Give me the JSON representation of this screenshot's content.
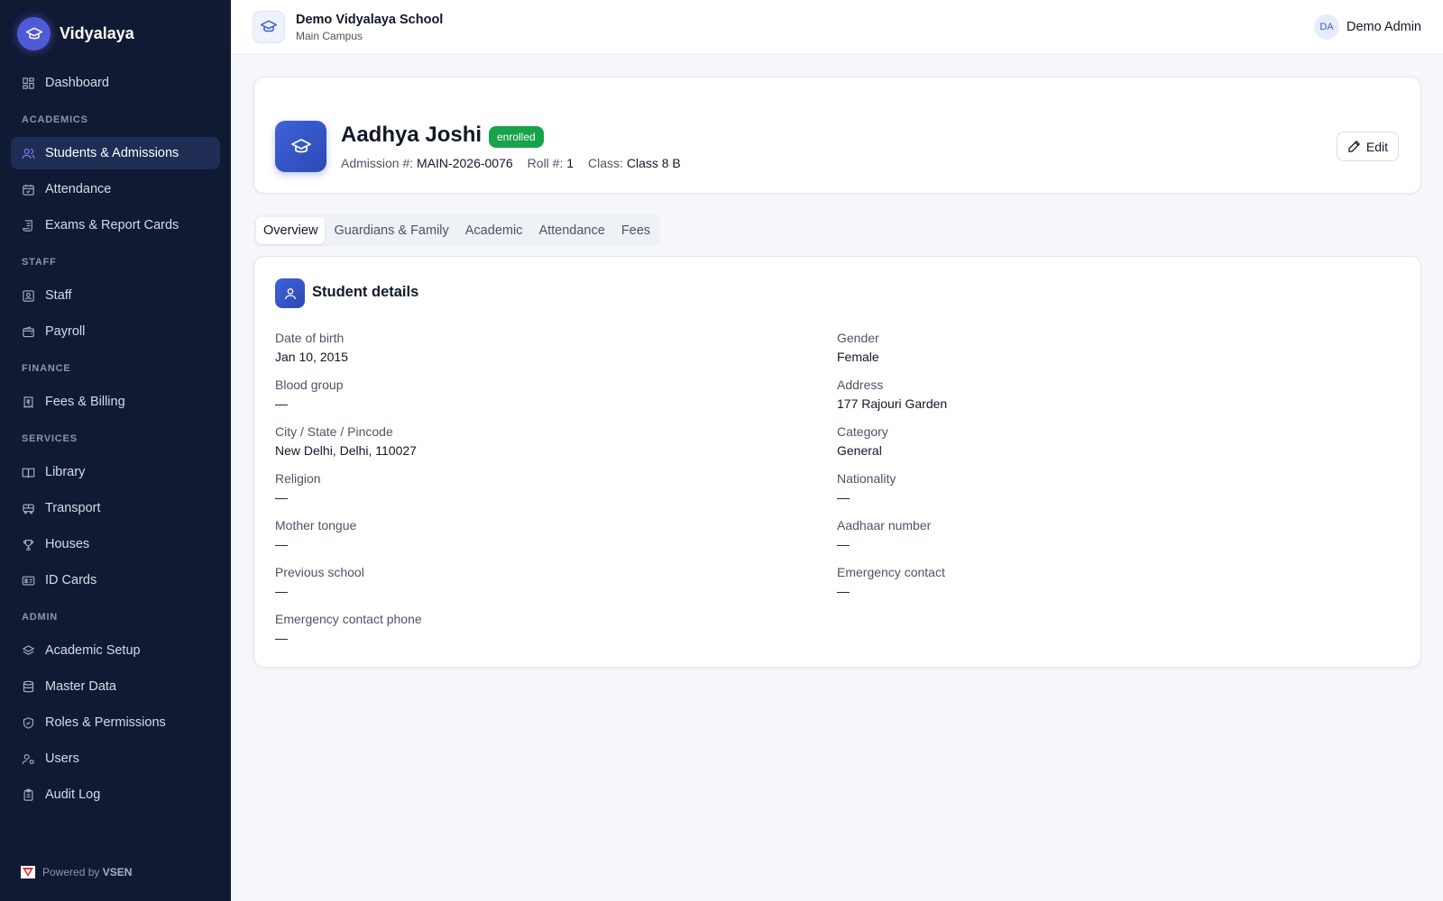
{
  "app": {
    "name": "Vidyalaya",
    "powered_by_prefix": "Powered by",
    "powered_by_brand": "VSEN"
  },
  "sidebar": {
    "dashboard": "Dashboard",
    "sections": {
      "academics": "ACADEMICS",
      "staff": "STAFF",
      "finance": "FINANCE",
      "services": "SERVICES",
      "admin": "ADMIN"
    },
    "items": {
      "students": "Students & Admissions",
      "attendance": "Attendance",
      "exams": "Exams & Report Cards",
      "staff": "Staff",
      "payroll": "Payroll",
      "fees": "Fees & Billing",
      "library": "Library",
      "transport": "Transport",
      "houses": "Houses",
      "id_cards": "ID Cards",
      "academic_setup": "Academic Setup",
      "master_data": "Master Data",
      "roles": "Roles & Permissions",
      "users": "Users",
      "audit_log": "Audit Log"
    },
    "active_item": "students"
  },
  "header": {
    "school_name": "Demo Vidyalaya School",
    "campus": "Main Campus",
    "user_initials": "DA",
    "user_name": "Demo Admin"
  },
  "student": {
    "name": "Aadhya Joshi",
    "status": "enrolled",
    "admission_label": "Admission #:",
    "admission_no": "MAIN-2026-0076",
    "roll_label": "Roll #:",
    "roll_no": "1",
    "class_label": "Class:",
    "class_name": "Class 8 B",
    "edit_label": "Edit"
  },
  "tabs": [
    "Overview",
    "Guardians & Family",
    "Academic",
    "Attendance",
    "Fees"
  ],
  "active_tab": "Overview",
  "details": {
    "title": "Student details",
    "fields": [
      {
        "label": "Date of birth",
        "value": "Jan 10, 2015"
      },
      {
        "label": "Gender",
        "value": "Female"
      },
      {
        "label": "Blood group",
        "value": "—"
      },
      {
        "label": "Address",
        "value": "177 Rajouri Garden"
      },
      {
        "label": "City / State / Pincode",
        "value": "New Delhi, Delhi, 110027"
      },
      {
        "label": "Category",
        "value": "General"
      },
      {
        "label": "Religion",
        "value": "—"
      },
      {
        "label": "Nationality",
        "value": "—"
      },
      {
        "label": "Mother tongue",
        "value": "—"
      },
      {
        "label": "Aadhaar number",
        "value": "—"
      },
      {
        "label": "Previous school",
        "value": "—"
      },
      {
        "label": "Emergency contact",
        "value": "—"
      },
      {
        "label": "Emergency contact phone",
        "value": "—"
      }
    ]
  },
  "colors": {
    "sidebar_bg": "#111a33",
    "active_nav_bg": "#1f2d55",
    "accent": "#3f63d8",
    "status_enrolled": "#16a34a"
  }
}
